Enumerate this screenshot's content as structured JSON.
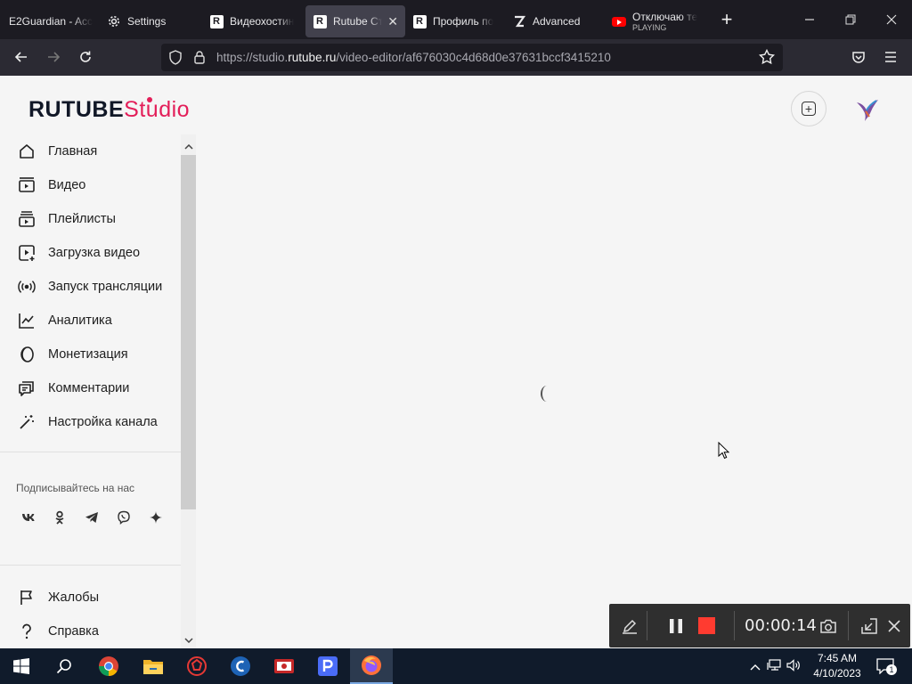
{
  "browser": {
    "tabs": [
      {
        "title": "E2Guardian - Acc",
        "icon": "none",
        "active": false
      },
      {
        "title": "Settings",
        "icon": "gear-icon",
        "active": false
      },
      {
        "title": "Видеохостин",
        "icon": "rutube-icon",
        "active": false
      },
      {
        "title": "Rutube Сту",
        "icon": "rutube-icon",
        "active": true
      },
      {
        "title": "Профиль по",
        "icon": "rutube-icon",
        "active": false
      },
      {
        "title": "Advanced",
        "icon": "advanced-icon",
        "active": false
      },
      {
        "title": "Отключаю те",
        "subtitle": "PLAYING",
        "icon": "youtube-icon",
        "active": false
      }
    ],
    "url_prefix": "https://studio.",
    "url_domain": "rutube.ru",
    "url_path": "/video-editor/af676030c4d68d0e37631bccf3415210"
  },
  "logo": {
    "brand": "RUTUBE",
    "product": "Studio",
    "brand_color": "#111827",
    "accent_color": "#e31e59"
  },
  "sidebar": {
    "items": [
      {
        "label": "Главная",
        "icon": "home-icon"
      },
      {
        "label": "Видео",
        "icon": "video-icon"
      },
      {
        "label": "Плейлисты",
        "icon": "playlist-icon"
      },
      {
        "label": "Загрузка видео",
        "icon": "upload-video-icon"
      },
      {
        "label": "Запуск трансляции",
        "icon": "broadcast-icon"
      },
      {
        "label": "Аналитика",
        "icon": "analytics-icon"
      },
      {
        "label": "Монетизация",
        "icon": "monetization-icon"
      },
      {
        "label": "Комментарии",
        "icon": "comments-icon"
      },
      {
        "label": "Настройка канала",
        "icon": "channel-settings-icon"
      }
    ],
    "follow_title": "Подписывайтесь на нас",
    "socials": [
      {
        "label": "VK",
        "icon": "vk-icon"
      },
      {
        "label": "OK",
        "icon": "ok-icon"
      },
      {
        "label": "Telegram",
        "icon": "telegram-icon"
      },
      {
        "label": "Viber",
        "icon": "viber-icon"
      },
      {
        "label": "Zen",
        "icon": "zen-icon"
      }
    ],
    "bottom_items": [
      {
        "label": "Жалобы",
        "icon": "flag-icon"
      },
      {
        "label": "Справка",
        "icon": "help-icon"
      }
    ]
  },
  "recorder": {
    "time": "00:00:14",
    "stop_color": "#ff3b30"
  },
  "taskbar": {
    "apps": [
      "windows-start-icon",
      "search-icon",
      "chrome-icon",
      "file-explorer-icon",
      "app-red-icon",
      "ccleaner-icon",
      "screen-recorder-icon",
      "p-app-icon",
      "firefox-icon"
    ],
    "clock_time": "7:45 AM",
    "clock_date": "4/10/2023",
    "notification_count": "1"
  }
}
